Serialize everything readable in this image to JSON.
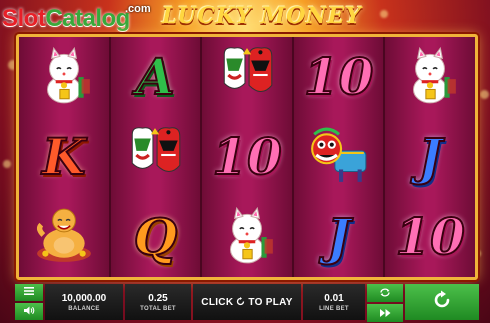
{
  "watermark": {
    "part1": "Slot",
    "part2": "Catalog",
    "suffix": ".com"
  },
  "title": "LUCKY MONEY",
  "reels": [
    [
      {
        "symbol": "cat",
        "icon": "lucky-cat-icon"
      },
      {
        "symbol": "K",
        "icon": "letter-k-icon"
      },
      {
        "symbol": "buddha",
        "icon": "buddha-icon"
      }
    ],
    [
      {
        "symbol": "A",
        "icon": "letter-a-icon"
      },
      {
        "symbol": "mask",
        "icon": "opera-mask-icon"
      },
      {
        "symbol": "Q",
        "icon": "letter-q-icon"
      }
    ],
    [
      {
        "symbol": "mask",
        "icon": "opera-mask-icon"
      },
      {
        "symbol": "10",
        "icon": "number-10-icon"
      },
      {
        "symbol": "cat",
        "icon": "lucky-cat-icon"
      }
    ],
    [
      {
        "symbol": "10",
        "icon": "number-10-icon"
      },
      {
        "symbol": "lion",
        "icon": "lion-dance-icon"
      },
      {
        "symbol": "J",
        "icon": "letter-j-icon"
      }
    ],
    [
      {
        "symbol": "cat",
        "icon": "lucky-cat-icon"
      },
      {
        "symbol": "J",
        "icon": "letter-j-icon"
      },
      {
        "symbol": "10",
        "icon": "number-10-icon"
      }
    ]
  ],
  "controls": {
    "balance_value": "10,000.00",
    "balance_label": "BALANCE",
    "total_bet_value": "0.25",
    "total_bet_label": "TOTAL BET",
    "play_label_pre": "CLICK",
    "play_label_post": "TO PLAY",
    "line_bet_value": "0.01",
    "line_bet_label": "LINE BET"
  },
  "colors": {
    "accent_green": "#37a83b",
    "frame_gold": "#f0b43a",
    "reel_magenta": "#a8185a"
  }
}
